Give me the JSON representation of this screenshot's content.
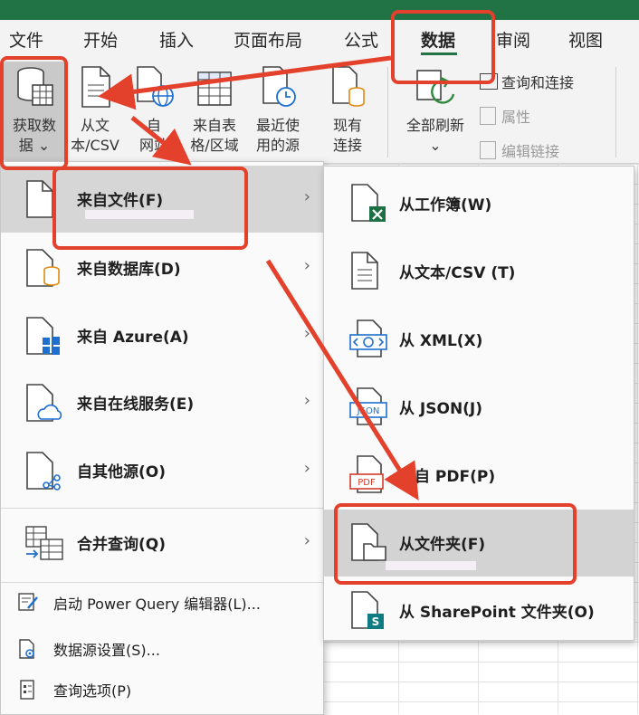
{
  "tabs": [
    "文件",
    "开始",
    "插入",
    "页面布局",
    "公式",
    "数据",
    "审阅",
    "视图"
  ],
  "active_tab": "数据",
  "ribbon": {
    "get_data": {
      "line1": "获取数",
      "line2": "据 ⌄"
    },
    "from_text": {
      "line1": "从文",
      "line2": "本/CSV"
    },
    "from_web": {
      "line1": "自",
      "line2": "网站"
    },
    "from_table": {
      "line1": "来自表",
      "line2": "格/区域"
    },
    "recent": {
      "line1": "最近使",
      "line2": "用的源"
    },
    "existing": {
      "line1": "现有",
      "line2": "连接"
    },
    "refresh_all": {
      "line1": "全部刷新",
      "line2": "⌄"
    },
    "queries": "查询和连接",
    "properties": "属性",
    "edit_links": "编辑链接"
  },
  "menu1": {
    "items": [
      {
        "label": "来自文件(F)",
        "icon": "file-icon"
      },
      {
        "label": "来自数据库(D)",
        "icon": "database-icon"
      },
      {
        "label": "来自 Azure(A)",
        "icon": "azure-icon"
      },
      {
        "label": "来自在线服务(E)",
        "icon": "cloud-icon"
      },
      {
        "label": "自其他源(O)",
        "icon": "other-sources-icon"
      },
      {
        "label": "合并查询(Q)",
        "icon": "combine-queries-icon"
      }
    ],
    "small": [
      {
        "label": "启动 Power Query 编辑器(L)...",
        "icon": "power-query-icon"
      },
      {
        "label": "数据源设置(S)...",
        "icon": "data-source-settings-icon"
      },
      {
        "label": "查询选项(P)",
        "icon": "query-options-icon"
      }
    ]
  },
  "menu2": {
    "items": [
      {
        "label": "从工作簿(W)",
        "icon": "excel-workbook-icon"
      },
      {
        "label": "从文本/CSV (T)",
        "icon": "text-file-icon"
      },
      {
        "label": "从 XML(X)",
        "icon": "xml-icon"
      },
      {
        "label": "从 JSON(J)",
        "icon": "json-icon"
      },
      {
        "label": "来自 PDF(P)",
        "icon": "pdf-icon"
      },
      {
        "label": "从文件夹(F)",
        "icon": "folder-icon"
      },
      {
        "label": "从 SharePoint 文件夹(O)",
        "icon": "sharepoint-icon"
      }
    ]
  },
  "icon_glyphs": {
    "json": "JSON",
    "pdf": "PDF",
    "sharepoint": "S"
  },
  "colors": {
    "accent": "#217346",
    "annotation": "#e4412c"
  }
}
